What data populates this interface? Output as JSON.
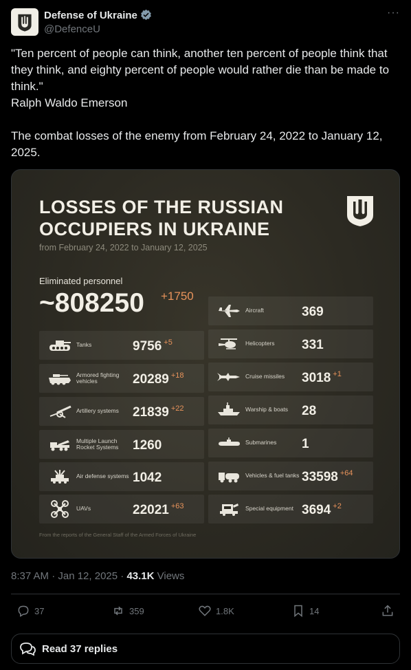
{
  "author": {
    "name": "Defense of Ukraine",
    "handle": "@DefenceU"
  },
  "tweet": {
    "text": "\"Ten percent of people can think, another ten percent of people think that they think, and eighty percent of people would rather die than be made to think.\"\nRalph Waldo Emerson\n\nThe combat losses of the enemy from February 24, 2022 to January 12, 2025."
  },
  "card": {
    "title_line1": "LOSSES OF THE RUSSIAN",
    "title_line2": "OCCUPIERS IN UKRAINE",
    "subtitle": "from February 24, 2022 to January 12, 2025",
    "personnel_label": "Eliminated personnel",
    "personnel_value": "~808250",
    "personnel_delta": "+1750",
    "footer": "From the reports of the General Staff of the Armed Forces of Ukraine",
    "left_items": [
      {
        "icon": "tank-icon",
        "label": "Tanks",
        "value": "9756",
        "delta": "+5"
      },
      {
        "icon": "armored-vehicle-icon",
        "label": "Armored fighting vehicles",
        "value": "20289",
        "delta": "+18"
      },
      {
        "icon": "artillery-icon",
        "label": "Artillery systems",
        "value": "21839",
        "delta": "+22"
      },
      {
        "icon": "rocket-launcher-icon",
        "label": "Multiple Launch Rocket Systems",
        "value": "1260",
        "delta": ""
      },
      {
        "icon": "air-defense-icon",
        "label": "Air defense systems",
        "value": "1042",
        "delta": ""
      },
      {
        "icon": "uav-icon",
        "label": "UAVs",
        "value": "22021",
        "delta": "+63"
      }
    ],
    "right_items": [
      {
        "icon": "aircraft-icon",
        "label": "Aircraft",
        "value": "369",
        "delta": ""
      },
      {
        "icon": "helicopter-icon",
        "label": "Helicopters",
        "value": "331",
        "delta": ""
      },
      {
        "icon": "cruise-missile-icon",
        "label": "Cruise missiles",
        "value": "3018",
        "delta": "+1"
      },
      {
        "icon": "warship-icon",
        "label": "Warship & boats",
        "value": "28",
        "delta": ""
      },
      {
        "icon": "submarine-icon",
        "label": "Submarines",
        "value": "1",
        "delta": ""
      },
      {
        "icon": "fuel-truck-icon",
        "label": "Vehicles & fuel tanks",
        "value": "33598",
        "delta": "+64"
      },
      {
        "icon": "special-equipment-icon",
        "label": "Special equipment",
        "value": "3694",
        "delta": "+2"
      }
    ]
  },
  "meta": {
    "time": "8:37 AM · Jan 12, 2025 · ",
    "views_count": "43.1K",
    "views_label": " Views"
  },
  "actions": {
    "replies": "37",
    "reposts": "359",
    "likes": "1.8K",
    "bookmarks": "14"
  },
  "read_replies": "Read 37 replies",
  "colors": {
    "background": "#000000",
    "card": "#2c2a22",
    "accent_delta": "#e8935b",
    "muted": "#71767b",
    "verified": "#829aab"
  }
}
